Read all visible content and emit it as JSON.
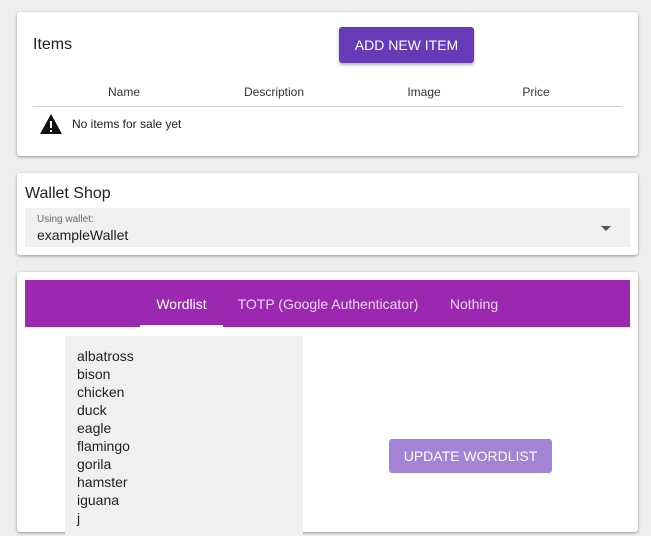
{
  "items": {
    "title": "Items",
    "add_button_label": "ADD NEW ITEM",
    "columns": [
      "Name",
      "Description",
      "Image",
      "Price"
    ],
    "empty_message": "No items for sale yet",
    "empty_icon": "warning-icon"
  },
  "wallet": {
    "title": "Wallet Shop",
    "select_label": "Using wallet:",
    "select_value": "exampleWallet",
    "caret_icon": "caret-down-icon"
  },
  "tabs": {
    "items": [
      "Wordlist",
      "TOTP (Google Authenticator)",
      "Nothing"
    ],
    "active_tab": "Wordlist",
    "color": "#9c27b0"
  },
  "wordlist": {
    "words": [
      "albatross",
      "bison",
      "chicken",
      "duck",
      "eagle",
      "flamingo",
      "gorila",
      "hamster",
      "iguana",
      "j"
    ],
    "update_button_label": "UPDATE WORDLIST"
  },
  "colors": {
    "add_button": "#673ab7",
    "update_button": "#a383d6",
    "background": "#eeeeee"
  }
}
